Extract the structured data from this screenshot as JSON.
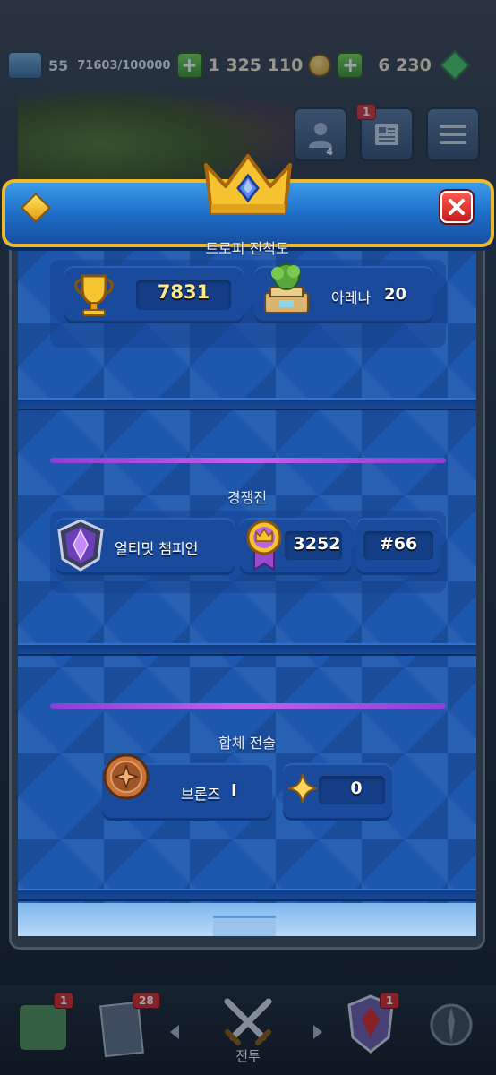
{
  "topbar": {
    "level": "55",
    "xp": "71603/100000",
    "gold": "1 325 110",
    "gems": "6 230"
  },
  "social": {
    "friends_count": "4",
    "news_badge": "1"
  },
  "trophy_section": {
    "title": "트로피 진척도",
    "trophies": "7831",
    "arena_label": "아레나",
    "arena_number": "20"
  },
  "ranked_section": {
    "title": "경쟁전",
    "league_name": "얼티밋 챔피언",
    "medals": "3252",
    "rank": "#66"
  },
  "merge_section": {
    "title": "합체 전술",
    "tier_label": "브론즈",
    "tier_level": "I",
    "stars": "0"
  },
  "bottom_nav": {
    "shop_badge": "1",
    "cards_badge": "28",
    "clan_badge": "1",
    "battle_label": "전투"
  },
  "colors": {
    "header_blue": "#1f6fc8",
    "header_gold_border": "#f0b726",
    "panel_blue": "#1e58ae",
    "purple_accent": "#c25ff0",
    "close_red": "#d62323"
  }
}
